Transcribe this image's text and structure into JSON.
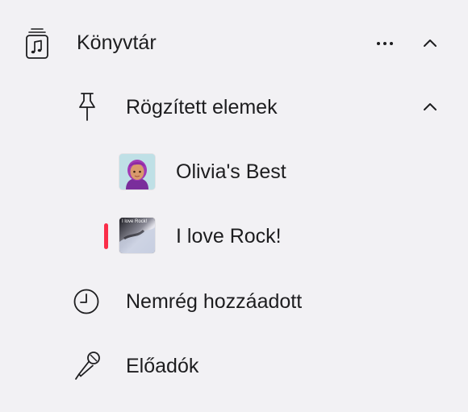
{
  "library": {
    "icon": "music-library-icon",
    "label": "Könyvtár",
    "more_icon": "ellipsis-icon",
    "collapse_icon": "chevron-up-icon"
  },
  "pinned": {
    "icon": "pin-icon",
    "label": "Rögzített elemek",
    "collapse_icon": "chevron-up-icon",
    "items": [
      {
        "label": "Olivia's Best",
        "artwork_icon": "memoji-artwork",
        "playing": false
      },
      {
        "label": "I love Rock!",
        "artwork_icon": "rock-playlist-artwork",
        "artwork_text": "I love Rock!",
        "playing": true
      }
    ]
  },
  "recently_added": {
    "icon": "clock-icon",
    "label": "Nemrég hozzáadott"
  },
  "artists": {
    "icon": "microphone-icon",
    "label": "Előadók"
  },
  "colors": {
    "background": "#f2f1f4",
    "text": "#1d1d1f",
    "accent": "#fa2d48"
  }
}
